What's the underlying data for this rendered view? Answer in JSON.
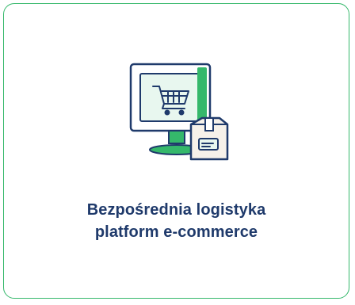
{
  "card": {
    "title_line_1": "Bezpośrednia logistyka",
    "title_line_2": "platform e-commerce",
    "icon": "ecommerce-monitor-cart-box-icon",
    "colors": {
      "border": "#35b86b",
      "title": "#1f3a6b",
      "icon_outline": "#1f3a6b",
      "icon_green": "#35b86b",
      "icon_screen": "#e8f7ef",
      "box_fill": "#f6f1ea"
    }
  }
}
